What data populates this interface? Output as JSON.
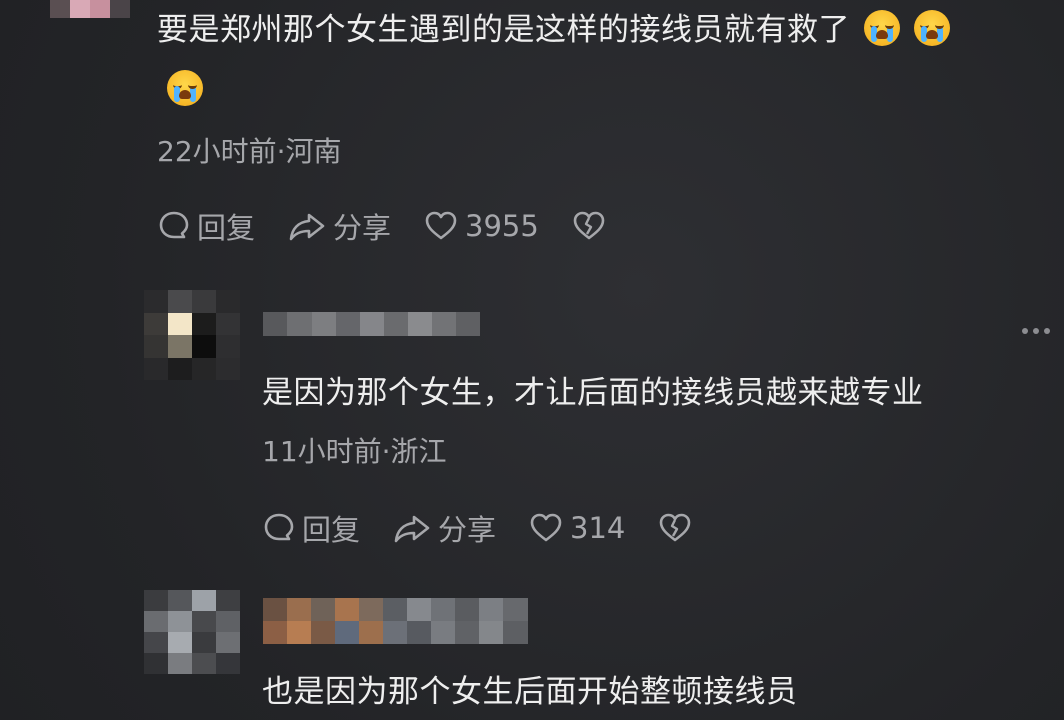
{
  "comments": [
    {
      "text": "要是郑州那个女生遇到的是这样的接线员就有救了",
      "emojis": [
        "loudly-crying-face",
        "loudly-crying-face",
        "loudly-crying-face"
      ],
      "meta": "22小时前·河南",
      "reply_label": "回复",
      "share_label": "分享",
      "likes": "3955"
    },
    {
      "text": "是因为那个女生，才让后面的接线员越来越专业",
      "meta": "11小时前·浙江",
      "reply_label": "回复",
      "share_label": "分享",
      "likes": "314"
    },
    {
      "text": "也是因为那个女生后面开始整顿接线员"
    }
  ],
  "icons": {
    "reply": "comment-bubble-icon",
    "share": "share-arrow-icon",
    "like": "heart-icon",
    "dislike": "broken-heart-icon",
    "more": "more-dots-icon"
  },
  "colors": {
    "background": "#26272a",
    "text": "#eeeeee",
    "muted": "#a6a7ab"
  }
}
